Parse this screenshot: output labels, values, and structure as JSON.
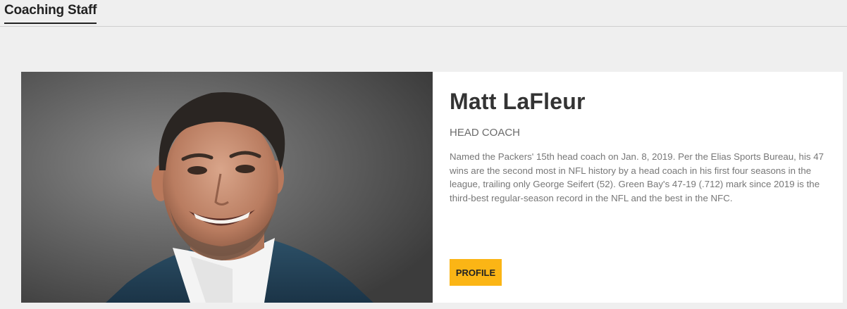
{
  "tabs": {
    "active_label": "Coaching Staff"
  },
  "coach": {
    "name": "Matt LaFleur",
    "title": "HEAD COACH",
    "bio": "Named the Packers' 15th head coach on Jan. 8, 2019. Per the Elias Sports Bureau, his 47 wins are the second most in NFL history by a head coach in his first four seasons in the league, trailing only George Seifert (52). Green Bay's 47-19 (.712) mark since 2019 is the third-best regular-season record in the NFL and the best in the NFC.",
    "profile_label": "PROFILE"
  },
  "colors": {
    "accent": "#fbb515",
    "background": "#efefef",
    "card": "#ffffff"
  }
}
